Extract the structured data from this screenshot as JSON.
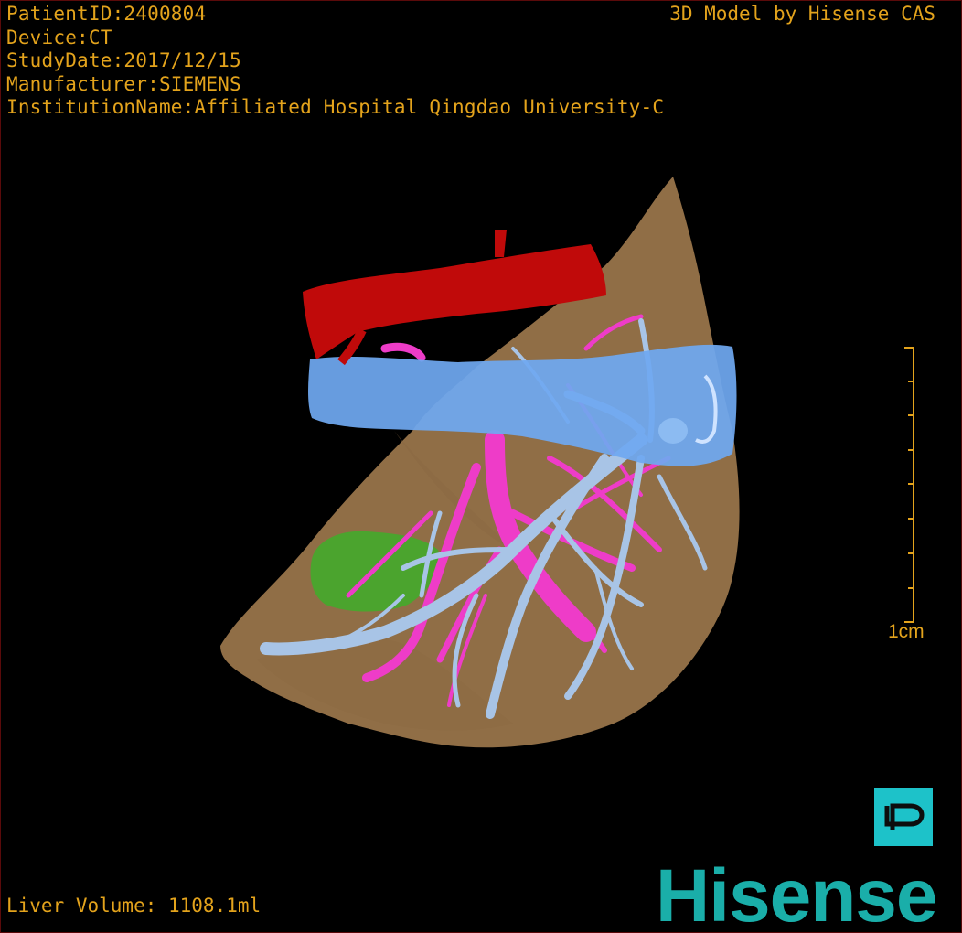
{
  "overlay": {
    "patient_id": "PatientID:2400804",
    "device": "Device:CT",
    "study_date": "StudyDate:2017/12/15",
    "manufacturer": "Manufacturer:SIEMENS",
    "institution": "InstitutionName:Affiliated Hospital Qingdao University-C",
    "model_credit": "3D Model by Hisense CAS",
    "liver_volume": "Liver Volume: 1108.1ml"
  },
  "scale_bar": {
    "label": "1cm"
  },
  "brand": {
    "logo_text": "Hisense"
  },
  "colors": {
    "text": "#e3a31c",
    "liver": "#a07a4e",
    "artery": "#c00a0a",
    "portal_vein": "#ee3cc8",
    "hepatic_vein": "#a8c4e6",
    "ivc": "#6fa8f0",
    "lesion": "#3fae2a",
    "brand": "#1aaea9",
    "view_button": "#1dc2c9"
  }
}
